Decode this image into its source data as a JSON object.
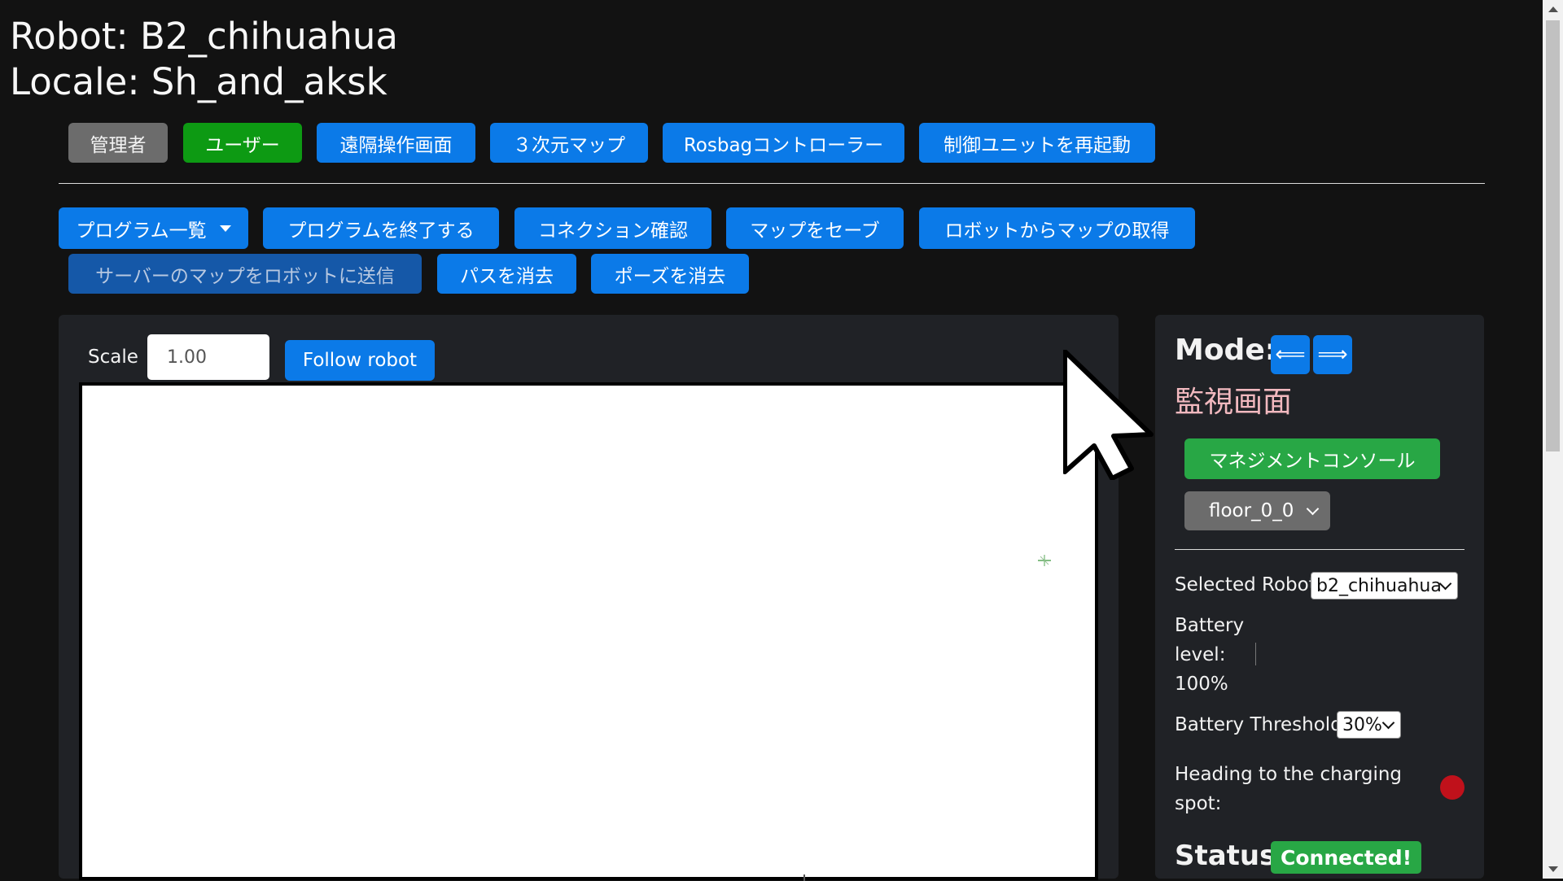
{
  "header": {
    "robot_line": "Robot: B2_chihuahua",
    "locale_line": "Locale: Sh_and_aksk"
  },
  "top_nav": {
    "admin": "管理者",
    "user": "ユーザー",
    "teleop": "遠隔操作画面",
    "map3d": "３次元マップ",
    "rosbag": "Rosbagコントローラー",
    "restart": "制御ユニットを再起動"
  },
  "actions": {
    "program_list": "プログラム一覧",
    "end_program": "プログラムを終了する",
    "check_connection": "コネクション確認",
    "save_map": "マップをセーブ",
    "get_map": "ロボットからマップの取得",
    "send_map": "サーバーのマップをロボットに送信",
    "clear_path": "パスを消去",
    "clear_pose": "ポーズを消去"
  },
  "map_panel": {
    "scale_label": "Scale",
    "scale_value": "1.00",
    "follow_label": "Follow robot"
  },
  "side_panel": {
    "mode_label": "Mode:",
    "prev_mode": "⟸",
    "next_mode": "⟹",
    "mode_name": "監視画面",
    "mgmt_console": "マネジメントコンソール",
    "floor_value": "floor_0_0",
    "selected_robot_label": "Selected Robot",
    "selected_robot_value": "b2_chihuahua",
    "battery_label_1": "Battery",
    "battery_label_2": "level:",
    "battery_value": "100%",
    "threshold_label": "Battery Threshold:",
    "threshold_value": "30%",
    "heading_label_1": "Heading to the charging",
    "heading_label_2": "spot:",
    "status_label": "Status:",
    "status_value": "Connected!"
  },
  "colors": {
    "background": "#121212",
    "primary_blue": "#0b7ae8",
    "admin_gray": "#6c6c6c",
    "user_green": "#0d9a13",
    "console_green": "#28a745",
    "status_green": "#28a745",
    "mode_name_pink": "#f2b9bf",
    "indicator_red": "#c0111b"
  }
}
